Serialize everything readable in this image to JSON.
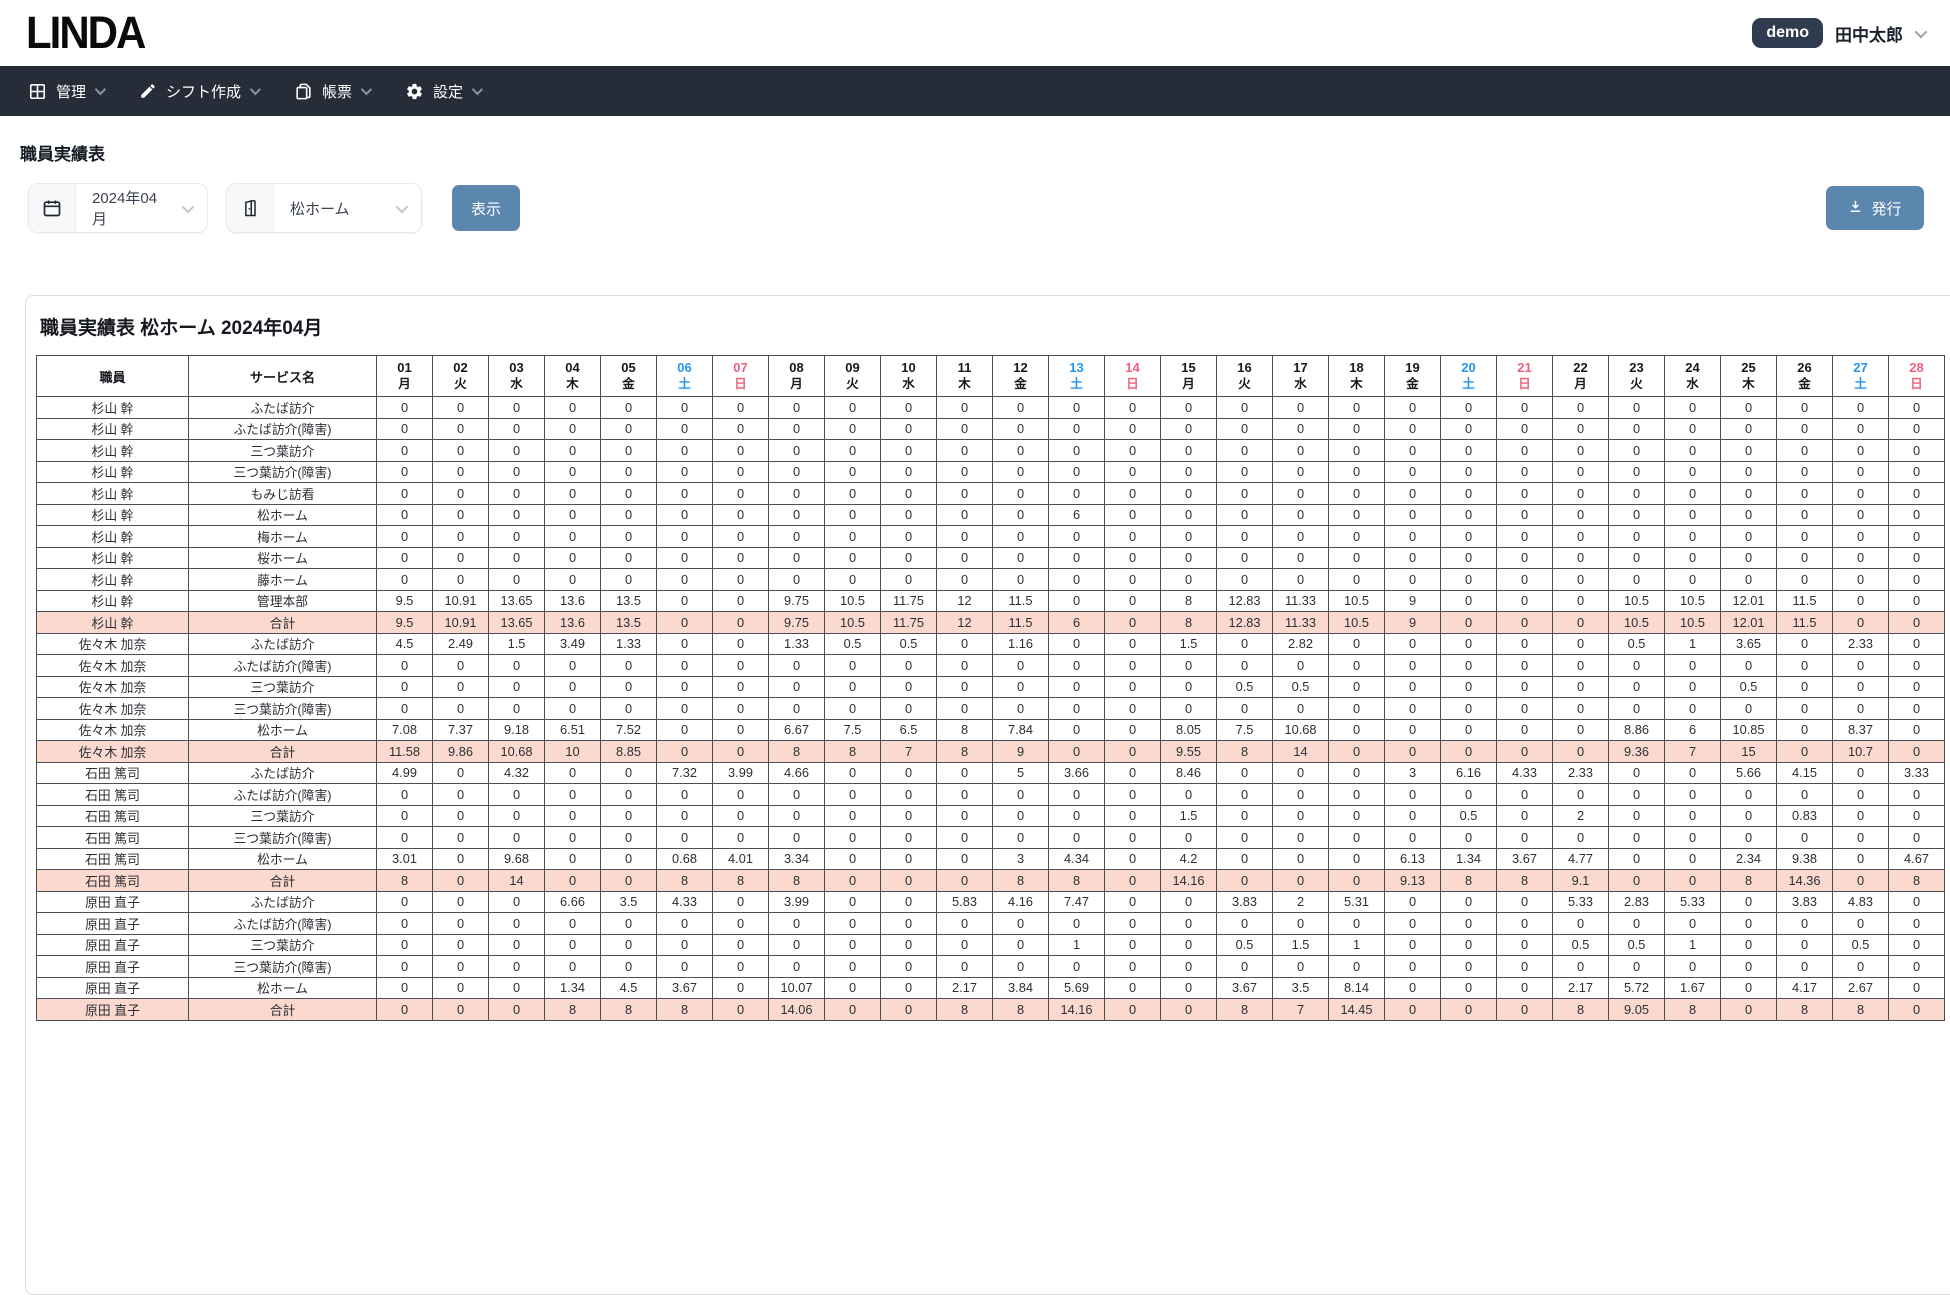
{
  "colors": {
    "accent": "#5b87ae",
    "nav_bg": "#272d38",
    "badge_bg": "#2f3c4f",
    "saturday": "#2095f3",
    "sunday": "#f15f7c",
    "total_row_bg": "#fbd9ce"
  },
  "header": {
    "logo": "LINDA",
    "env_badge": "demo",
    "user_name": "田中太郎"
  },
  "nav": {
    "items": [
      {
        "label": "管理",
        "icon": "grid-icon"
      },
      {
        "label": "シフト作成",
        "icon": "pencil-icon"
      },
      {
        "label": "帳票",
        "icon": "report-icon"
      },
      {
        "label": "設定",
        "icon": "gear-icon"
      }
    ]
  },
  "page": {
    "title": "職員実績表"
  },
  "filters": {
    "month": "2024年04月",
    "facility": "松ホーム",
    "show_button": "表示",
    "publish_button": "発行"
  },
  "report": {
    "title": "職員実績表 松ホーム 2024年04月",
    "columns": {
      "staff": "職員",
      "service": "サービス名"
    },
    "days": [
      {
        "num": "01",
        "dow": "月"
      },
      {
        "num": "02",
        "dow": "火"
      },
      {
        "num": "03",
        "dow": "水"
      },
      {
        "num": "04",
        "dow": "木"
      },
      {
        "num": "05",
        "dow": "金"
      },
      {
        "num": "06",
        "dow": "土"
      },
      {
        "num": "07",
        "dow": "日"
      },
      {
        "num": "08",
        "dow": "月"
      },
      {
        "num": "09",
        "dow": "火"
      },
      {
        "num": "10",
        "dow": "水"
      },
      {
        "num": "11",
        "dow": "木"
      },
      {
        "num": "12",
        "dow": "金"
      },
      {
        "num": "13",
        "dow": "土"
      },
      {
        "num": "14",
        "dow": "日"
      },
      {
        "num": "15",
        "dow": "月"
      },
      {
        "num": "16",
        "dow": "火"
      },
      {
        "num": "17",
        "dow": "水"
      },
      {
        "num": "18",
        "dow": "木"
      },
      {
        "num": "19",
        "dow": "金"
      },
      {
        "num": "20",
        "dow": "土"
      },
      {
        "num": "21",
        "dow": "日"
      },
      {
        "num": "22",
        "dow": "月"
      },
      {
        "num": "23",
        "dow": "火"
      },
      {
        "num": "24",
        "dow": "水"
      },
      {
        "num": "25",
        "dow": "木"
      },
      {
        "num": "26",
        "dow": "金"
      },
      {
        "num": "27",
        "dow": "土"
      },
      {
        "num": "28",
        "dow": "日"
      }
    ],
    "groups": [
      {
        "staff": "杉山 幹",
        "rows": [
          {
            "service": "ふたば訪介",
            "values": [
              0,
              0,
              0,
              0,
              0,
              0,
              0,
              0,
              0,
              0,
              0,
              0,
              0,
              0,
              0,
              0,
              0,
              0,
              0,
              0,
              0,
              0,
              0,
              0,
              0,
              0,
              0,
              0
            ]
          },
          {
            "service": "ふたば訪介(障害)",
            "values": [
              0,
              0,
              0,
              0,
              0,
              0,
              0,
              0,
              0,
              0,
              0,
              0,
              0,
              0,
              0,
              0,
              0,
              0,
              0,
              0,
              0,
              0,
              0,
              0,
              0,
              0,
              0,
              0
            ]
          },
          {
            "service": "三つ葉訪介",
            "values": [
              0,
              0,
              0,
              0,
              0,
              0,
              0,
              0,
              0,
              0,
              0,
              0,
              0,
              0,
              0,
              0,
              0,
              0,
              0,
              0,
              0,
              0,
              0,
              0,
              0,
              0,
              0,
              0
            ]
          },
          {
            "service": "三つ葉訪介(障害)",
            "values": [
              0,
              0,
              0,
              0,
              0,
              0,
              0,
              0,
              0,
              0,
              0,
              0,
              0,
              0,
              0,
              0,
              0,
              0,
              0,
              0,
              0,
              0,
              0,
              0,
              0,
              0,
              0,
              0
            ]
          },
          {
            "service": "もみじ訪看",
            "values": [
              0,
              0,
              0,
              0,
              0,
              0,
              0,
              0,
              0,
              0,
              0,
              0,
              0,
              0,
              0,
              0,
              0,
              0,
              0,
              0,
              0,
              0,
              0,
              0,
              0,
              0,
              0,
              0
            ]
          },
          {
            "service": "松ホーム",
            "values": [
              0,
              0,
              0,
              0,
              0,
              0,
              0,
              0,
              0,
              0,
              0,
              0,
              6,
              0,
              0,
              0,
              0,
              0,
              0,
              0,
              0,
              0,
              0,
              0,
              0,
              0,
              0,
              0
            ]
          },
          {
            "service": "梅ホーム",
            "values": [
              0,
              0,
              0,
              0,
              0,
              0,
              0,
              0,
              0,
              0,
              0,
              0,
              0,
              0,
              0,
              0,
              0,
              0,
              0,
              0,
              0,
              0,
              0,
              0,
              0,
              0,
              0,
              0
            ]
          },
          {
            "service": "桜ホーム",
            "values": [
              0,
              0,
              0,
              0,
              0,
              0,
              0,
              0,
              0,
              0,
              0,
              0,
              0,
              0,
              0,
              0,
              0,
              0,
              0,
              0,
              0,
              0,
              0,
              0,
              0,
              0,
              0,
              0
            ]
          },
          {
            "service": "藤ホーム",
            "values": [
              0,
              0,
              0,
              0,
              0,
              0,
              0,
              0,
              0,
              0,
              0,
              0,
              0,
              0,
              0,
              0,
              0,
              0,
              0,
              0,
              0,
              0,
              0,
              0,
              0,
              0,
              0,
              0
            ]
          },
          {
            "service": "管理本部",
            "values": [
              9.5,
              10.91,
              13.65,
              13.6,
              13.5,
              0,
              0,
              9.75,
              10.5,
              11.75,
              12,
              11.5,
              0,
              0,
              8,
              12.83,
              11.33,
              10.5,
              9,
              0,
              0,
              0,
              10.5,
              10.5,
              12.01,
              11.5,
              0,
              0
            ]
          },
          {
            "service": "合計",
            "total": true,
            "values": [
              9.5,
              10.91,
              13.65,
              13.6,
              13.5,
              0,
              0,
              9.75,
              10.5,
              11.75,
              12,
              11.5,
              6,
              0,
              8,
              12.83,
              11.33,
              10.5,
              9,
              0,
              0,
              0,
              10.5,
              10.5,
              12.01,
              11.5,
              0,
              0
            ]
          }
        ]
      },
      {
        "staff": "佐々木 加奈",
        "rows": [
          {
            "service": "ふたば訪介",
            "values": [
              4.5,
              2.49,
              1.5,
              3.49,
              1.33,
              0,
              0,
              1.33,
              0.5,
              0.5,
              0,
              1.16,
              0,
              0,
              1.5,
              0,
              2.82,
              0,
              0,
              0,
              0,
              0,
              0.5,
              1,
              3.65,
              0,
              2.33,
              0
            ]
          },
          {
            "service": "ふたば訪介(障害)",
            "values": [
              0,
              0,
              0,
              0,
              0,
              0,
              0,
              0,
              0,
              0,
              0,
              0,
              0,
              0,
              0,
              0,
              0,
              0,
              0,
              0,
              0,
              0,
              0,
              0,
              0,
              0,
              0,
              0
            ]
          },
          {
            "service": "三つ葉訪介",
            "values": [
              0,
              0,
              0,
              0,
              0,
              0,
              0,
              0,
              0,
              0,
              0,
              0,
              0,
              0,
              0,
              0.5,
              0.5,
              0,
              0,
              0,
              0,
              0,
              0,
              0,
              0.5,
              0,
              0,
              0
            ]
          },
          {
            "service": "三つ葉訪介(障害)",
            "values": [
              0,
              0,
              0,
              0,
              0,
              0,
              0,
              0,
              0,
              0,
              0,
              0,
              0,
              0,
              0,
              0,
              0,
              0,
              0,
              0,
              0,
              0,
              0,
              0,
              0,
              0,
              0,
              0
            ]
          },
          {
            "service": "松ホーム",
            "values": [
              7.08,
              7.37,
              9.18,
              6.51,
              7.52,
              0,
              0,
              6.67,
              7.5,
              6.5,
              8,
              7.84,
              0,
              0,
              8.05,
              7.5,
              10.68,
              0,
              0,
              0,
              0,
              0,
              8.86,
              6,
              10.85,
              0,
              8.37,
              0
            ]
          },
          {
            "service": "合計",
            "total": true,
            "values": [
              11.58,
              9.86,
              10.68,
              10,
              8.85,
              0,
              0,
              8,
              8,
              7,
              8,
              9,
              0,
              0,
              9.55,
              8,
              14,
              0,
              0,
              0,
              0,
              0,
              9.36,
              7,
              15,
              0,
              10.7,
              0
            ]
          }
        ]
      },
      {
        "staff": "石田 篤司",
        "rows": [
          {
            "service": "ふたば訪介",
            "values": [
              4.99,
              0,
              4.32,
              0,
              0,
              7.32,
              3.99,
              4.66,
              0,
              0,
              0,
              5,
              3.66,
              0,
              8.46,
              0,
              0,
              0,
              3,
              6.16,
              4.33,
              2.33,
              0,
              0,
              5.66,
              4.15,
              0,
              3.33
            ]
          },
          {
            "service": "ふたば訪介(障害)",
            "values": [
              0,
              0,
              0,
              0,
              0,
              0,
              0,
              0,
              0,
              0,
              0,
              0,
              0,
              0,
              0,
              0,
              0,
              0,
              0,
              0,
              0,
              0,
              0,
              0,
              0,
              0,
              0,
              0
            ]
          },
          {
            "service": "三つ葉訪介",
            "values": [
              0,
              0,
              0,
              0,
              0,
              0,
              0,
              0,
              0,
              0,
              0,
              0,
              0,
              0,
              1.5,
              0,
              0,
              0,
              0,
              0.5,
              0,
              2,
              0,
              0,
              0,
              0.83,
              0,
              0
            ]
          },
          {
            "service": "三つ葉訪介(障害)",
            "values": [
              0,
              0,
              0,
              0,
              0,
              0,
              0,
              0,
              0,
              0,
              0,
              0,
              0,
              0,
              0,
              0,
              0,
              0,
              0,
              0,
              0,
              0,
              0,
              0,
              0,
              0,
              0,
              0
            ]
          },
          {
            "service": "松ホーム",
            "values": [
              3.01,
              0,
              9.68,
              0,
              0,
              0.68,
              4.01,
              3.34,
              0,
              0,
              0,
              3,
              4.34,
              0,
              4.2,
              0,
              0,
              0,
              6.13,
              1.34,
              3.67,
              4.77,
              0,
              0,
              2.34,
              9.38,
              0,
              4.67
            ]
          },
          {
            "service": "合計",
            "total": true,
            "values": [
              8,
              0,
              14,
              0,
              0,
              8,
              8,
              8,
              0,
              0,
              0,
              8,
              8,
              0,
              14.16,
              0,
              0,
              0,
              9.13,
              8,
              8,
              9.1,
              0,
              0,
              8,
              14.36,
              0,
              8
            ]
          }
        ]
      },
      {
        "staff": "原田 直子",
        "rows": [
          {
            "service": "ふたば訪介",
            "values": [
              0,
              0,
              0,
              6.66,
              3.5,
              4.33,
              0,
              3.99,
              0,
              0,
              5.83,
              4.16,
              7.47,
              0,
              0,
              3.83,
              2,
              5.31,
              0,
              0,
              0,
              5.33,
              2.83,
              5.33,
              0,
              3.83,
              4.83,
              0
            ]
          },
          {
            "service": "ふたば訪介(障害)",
            "values": [
              0,
              0,
              0,
              0,
              0,
              0,
              0,
              0,
              0,
              0,
              0,
              0,
              0,
              0,
              0,
              0,
              0,
              0,
              0,
              0,
              0,
              0,
              0,
              0,
              0,
              0,
              0,
              0
            ]
          },
          {
            "service": "三つ葉訪介",
            "values": [
              0,
              0,
              0,
              0,
              0,
              0,
              0,
              0,
              0,
              0,
              0,
              0,
              1,
              0,
              0,
              0.5,
              1.5,
              1,
              0,
              0,
              0,
              0.5,
              0.5,
              1,
              0,
              0,
              0.5,
              0
            ]
          },
          {
            "service": "三つ葉訪介(障害)",
            "values": [
              0,
              0,
              0,
              0,
              0,
              0,
              0,
              0,
              0,
              0,
              0,
              0,
              0,
              0,
              0,
              0,
              0,
              0,
              0,
              0,
              0,
              0,
              0,
              0,
              0,
              0,
              0,
              0
            ]
          },
          {
            "service": "松ホーム",
            "values": [
              0,
              0,
              0,
              1.34,
              4.5,
              3.67,
              0,
              10.07,
              0,
              0,
              2.17,
              3.84,
              5.69,
              0,
              0,
              3.67,
              3.5,
              8.14,
              0,
              0,
              0,
              2.17,
              5.72,
              1.67,
              0,
              4.17,
              2.67,
              0
            ]
          },
          {
            "service": "合計",
            "total": true,
            "values": [
              0,
              0,
              0,
              8,
              8,
              8,
              0,
              14.06,
              0,
              0,
              8,
              8,
              14.16,
              0,
              0,
              8,
              7,
              14.45,
              0,
              0,
              0,
              8,
              9.05,
              8,
              0,
              8,
              8,
              0
            ]
          }
        ]
      }
    ]
  }
}
